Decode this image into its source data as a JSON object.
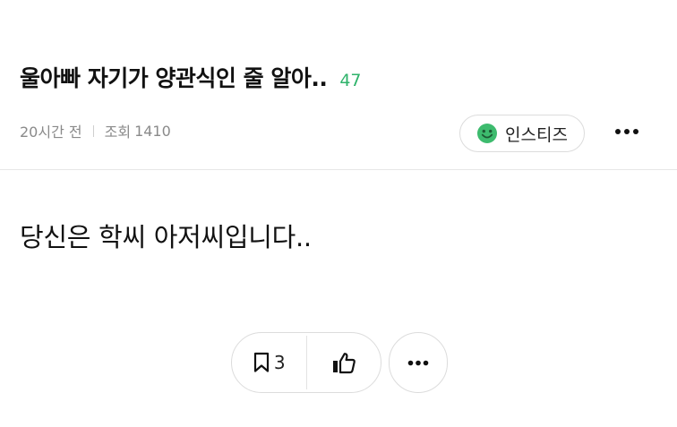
{
  "post": {
    "title": "울아빠 자기가 양관식인 줄 알아..",
    "comment_count": "47",
    "time_ago": "20시간 전",
    "views_label": "조회",
    "views_count": "1410",
    "board": {
      "name": "인스티즈",
      "icon": "smiley-face-icon",
      "icon_color": "#3dbb6e"
    },
    "body": "당신은 학씨 아저씨입니다.."
  },
  "actions": {
    "bookmark_count": "3",
    "bookmark_icon": "bookmark-icon",
    "like_icon": "thumbs-up-icon",
    "more_icon": "more-dots-icon"
  },
  "colors": {
    "comment_count": "#2fb36b",
    "meta_text": "#8a8a8a",
    "border": "#dcdcdc"
  }
}
